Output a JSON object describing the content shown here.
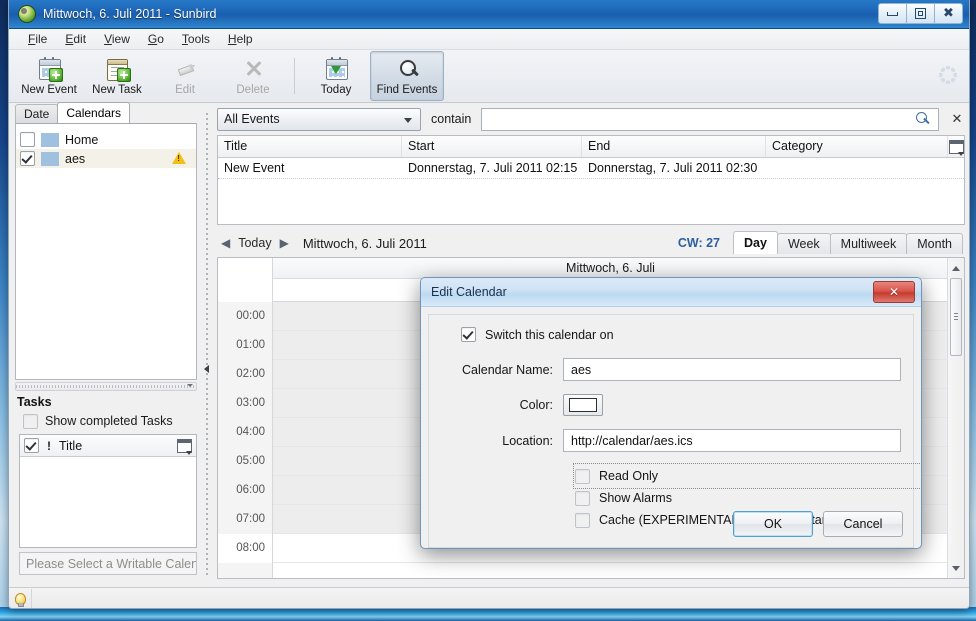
{
  "window": {
    "title": "Mittwoch, 6. Juli 2011 - Sunbird",
    "icon": "sunbird-icon",
    "controls": {
      "minimize": "minimize",
      "restore": "restore",
      "close": "close"
    }
  },
  "menubar": {
    "items": [
      "File",
      "Edit",
      "View",
      "Go",
      "Tools",
      "Help"
    ]
  },
  "toolbar": {
    "buttons": [
      {
        "label": "New Event",
        "icon": "new-event-icon",
        "state": "enabled"
      },
      {
        "label": "New Task",
        "icon": "new-task-icon",
        "state": "enabled"
      },
      {
        "label": "Edit",
        "icon": "edit-icon",
        "state": "disabled"
      },
      {
        "label": "Delete",
        "icon": "delete-icon",
        "state": "disabled"
      },
      {
        "label": "Today",
        "icon": "today-icon",
        "state": "enabled"
      },
      {
        "label": "Find Events",
        "icon": "find-events-icon",
        "state": "active"
      }
    ],
    "throbber": "throbber-icon"
  },
  "sidebar": {
    "tabs": [
      {
        "label": "Date",
        "selected": false
      },
      {
        "label": "Calendars",
        "selected": true
      }
    ],
    "calendars": [
      {
        "name": "Home",
        "checked": false,
        "color": "#9fc0de",
        "warning": false
      },
      {
        "name": "aes",
        "checked": true,
        "color": "#9fc0de",
        "warning": true,
        "selected": true
      }
    ],
    "tasks": {
      "heading": "Tasks",
      "show_completed_label": "Show completed Tasks",
      "show_completed_checked": false,
      "columns": {
        "priority": "!",
        "title": "Title"
      },
      "new_task_placeholder": "Please Select a Writable Calend"
    }
  },
  "search": {
    "scope_value": "All Events",
    "contain_label": "contain",
    "query_value": "",
    "search_icon": "search-icon",
    "clear_label": "✕"
  },
  "events_table": {
    "columns": [
      "Title",
      "Start",
      "End",
      "Category"
    ],
    "rows": [
      {
        "title": "New Event",
        "start": "Donnerstag, 7. Juli 2011 02:15",
        "end": "Donnerstag, 7. Juli 2011 02:30",
        "category": ""
      }
    ]
  },
  "calendar_nav": {
    "prev_label": "◀",
    "today_label": "Today",
    "next_label": "▶",
    "current_date": "Mittwoch, 6. Juli 2011",
    "cw_label": "CW: 27",
    "views": [
      {
        "label": "Day",
        "selected": true
      },
      {
        "label": "Week",
        "selected": false
      },
      {
        "label": "Multiweek",
        "selected": false
      },
      {
        "label": "Month",
        "selected": false
      }
    ]
  },
  "day_view": {
    "day_header": "Mittwoch, 6. Juli",
    "hours": [
      "00:00",
      "01:00",
      "02:00",
      "03:00",
      "04:00",
      "05:00",
      "06:00",
      "07:00",
      "08:00"
    ]
  },
  "statusbar": {
    "icon": "lightbulb-icon",
    "text": ""
  },
  "dialog": {
    "title": "Edit Calendar",
    "close_label": "✕",
    "switch_on_label": "Switch this calendar on",
    "switch_on_checked": true,
    "name_label": "Calendar Name:",
    "name_value": "aes",
    "color_label": "Color:",
    "color_value": "#ffffff",
    "location_label": "Location:",
    "location_value": "http://calendar/aes.ics",
    "options": [
      {
        "label": "Read Only",
        "checked": false,
        "focused": true
      },
      {
        "label": "Show Alarms",
        "checked": false,
        "focused": false
      },
      {
        "label": "Cache (EXPERIMENTAL, requires restart)",
        "checked": false,
        "focused": false
      }
    ],
    "ok_label": "OK",
    "cancel_label": "Cancel"
  }
}
